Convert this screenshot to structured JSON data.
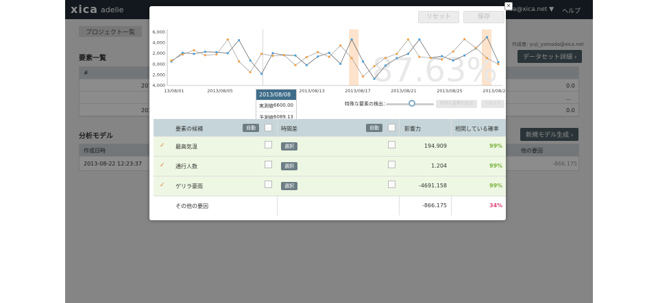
{
  "app": {
    "logo": "xica",
    "sub": "adelie",
    "user": "yamada@xica.net ▼",
    "help": "ヘルプ"
  },
  "background": {
    "breadcrumb": "プロジェクト一覧",
    "elements_title": "要素一覧",
    "dataset_button": "データセット詳細 ›",
    "author": "作成者: yuji_yamada@xica.net",
    "model_title": "分析モデル",
    "new_model_button": "新規モデル生成 ›",
    "created_header": "作成日時",
    "created_value": "2013-08-22 12:23:37",
    "other_header": "他の要因",
    "other_value": "-866.175",
    "hash_header": "#",
    "rows": [
      "201",
      "201"
    ],
    "right_values": [
      "0.0",
      "...",
      "0.0",
      "0.0"
    ]
  },
  "modal": {
    "reset": "リセット",
    "save": "保存",
    "close": "×",
    "big_percent": "87.63%",
    "tooltip": {
      "date": "2013/08/08",
      "actual_label": "実測値",
      "actual_value": "6600.00",
      "pred_label": "予測値",
      "pred_value": "6089.13"
    },
    "detect_label": "特殊な要素の検出：",
    "detect_btn1": "特殊な要素の追加",
    "detect_btn2": "リセット"
  },
  "chart_data": {
    "type": "line",
    "y_ticks": [
      "6,000",
      "4,000",
      "2,000",
      "0,000",
      "2,000",
      "4,000"
    ],
    "x_ticks": [
      "13/08/01",
      "2013/08/05",
      "201",
      "2013/08/13",
      "2013/08/17",
      "2013/08/21",
      "2013/08/25",
      "2013/08/29"
    ],
    "series": [
      {
        "values": [
          -0.8,
          1.8,
          1.5,
          2.1,
          2.0,
          1.7,
          5.6,
          -0.5,
          -4.5,
          1.7,
          1.1,
          1.0,
          -1.9,
          0.7,
          1.8,
          -1.5,
          5.8,
          -0.8,
          -6.0,
          -2.0,
          0.2,
          1.5,
          5.8,
          0.3,
          0.8,
          -0.5,
          1.0,
          3.1,
          6.5,
          -1.0
        ]
      },
      {
        "values": [
          -0.5,
          1.3,
          2.6,
          1.1,
          1.3,
          5.8,
          -0.8,
          -4.0,
          1.5,
          0.9,
          1.1,
          -1.9,
          0.5,
          2.0,
          0.6,
          4.0,
          0.2,
          -5.3,
          -2.2,
          0.3,
          1.5,
          5.8,
          0.6,
          0.3,
          -0.2,
          2.2,
          5.9,
          3.3,
          0.2,
          -1.6
        ]
      }
    ],
    "colors": [
      "#4a9ed8",
      "#f0a043"
    ],
    "highlight_color": "#fde3cc"
  },
  "grid": {
    "headers": [
      "要素の候補",
      "自動",
      "時間差",
      "自動",
      "影響力",
      "相関している確率"
    ],
    "rows": [
      {
        "check": "✓",
        "name": "最高気温",
        "select": "選択",
        "impact": "194.909",
        "prob": "99%"
      },
      {
        "check": "✓",
        "name": "通行人数",
        "select": "選択",
        "impact": "1.204",
        "prob": "99%"
      },
      {
        "check": "✓",
        "name": "ゲリラ豪雨",
        "select": "選択",
        "impact": "-4691.158",
        "prob": "99%"
      },
      {
        "check": "",
        "name": "その他の要因",
        "select": "",
        "impact": "-866.175",
        "prob": "34%"
      }
    ],
    "prob_colors": [
      "#7cb342",
      "#7cb342",
      "#7cb342",
      "#e0457b"
    ]
  }
}
